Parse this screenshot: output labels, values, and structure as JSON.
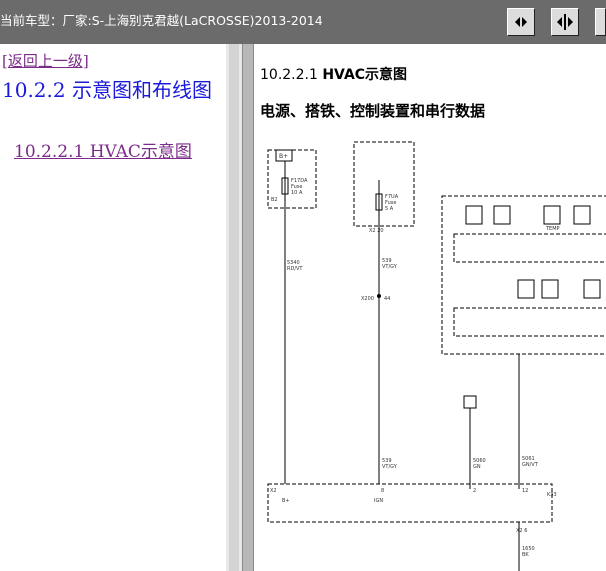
{
  "window": {
    "title": "当前车型：厂家:S-上海别克君越(LaCROSSE)2013-2014"
  },
  "toolbar": {
    "buttons": [
      "expand-pane",
      "split-view",
      "collapse-pane"
    ]
  },
  "nav": {
    "back_link": "[返回上一级]",
    "section_title": "10.2.2 示意图和布线图",
    "sub_link": "10.2.2.1 HVAC示意图"
  },
  "doc": {
    "heading_number": "10.2.2.1",
    "heading_text": "HVAC示意图",
    "subheading": "电源、搭铁、控制装置和串行数据"
  },
  "diagram": {
    "fuse1": {
      "label": "F17DA",
      "sub": "Fuse",
      "amps": "10 A",
      "pin": "B2",
      "power": "B+"
    },
    "fuse2": {
      "label": "F7UA",
      "sub": "Fuse",
      "amps": "5 A"
    },
    "connector_x2_20": "X2  20",
    "wire1": {
      "circuit": "5340",
      "color": "RD/VT"
    },
    "wire2": {
      "circuit": "539",
      "color": "VT/GY"
    },
    "splice": "X200",
    "splice_pin": "44",
    "wire3": {
      "circuit": "539",
      "color": "VT/GY"
    },
    "wire4": {
      "circuit": "5060",
      "color": "GN"
    },
    "wire5": {
      "circuit": "5061",
      "color": "GN/VT"
    },
    "x2_left": "X2",
    "pin_bplus": "B+",
    "pin_ign": "IGN",
    "pin_8": "8",
    "pin_2": "2",
    "pin_12": "12",
    "module_label": "K33",
    "bottom_pin": "X2  6",
    "wire6": {
      "circuit": "1650",
      "color": "BK"
    },
    "temp_label": "TEMP"
  }
}
